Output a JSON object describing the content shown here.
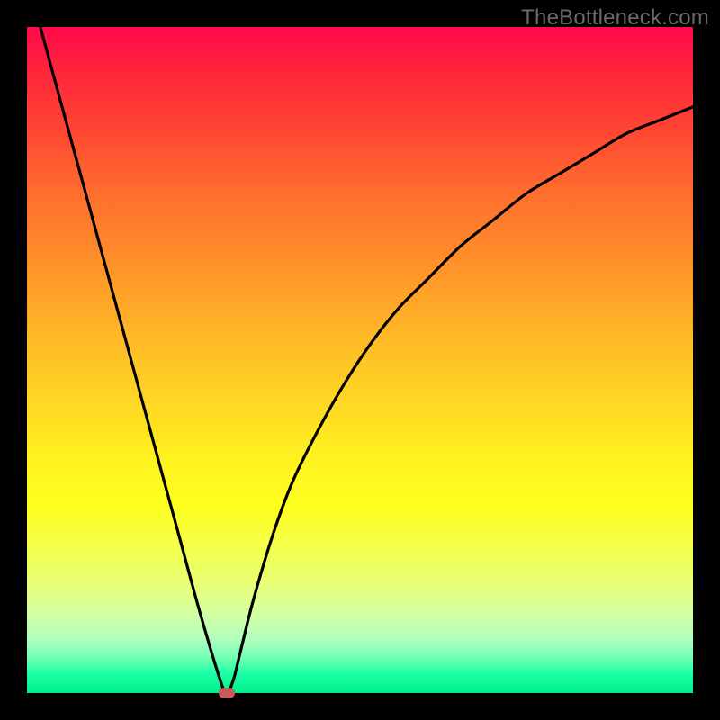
{
  "watermark": "TheBottleneck.com",
  "colors": {
    "frame": "#000000",
    "curve": "#000000",
    "marker": "#c85a5a"
  },
  "chart_data": {
    "type": "line",
    "title": "",
    "xlabel": "",
    "ylabel": "",
    "xlim": [
      0,
      100
    ],
    "ylim": [
      0,
      100
    ],
    "grid": false,
    "series": [
      {
        "name": "bottleneck-curve",
        "x": [
          2,
          5,
          8,
          11,
          14,
          17,
          20,
          23,
          26,
          29,
          30,
          31,
          32,
          34,
          37,
          40,
          44,
          48,
          52,
          56,
          60,
          65,
          70,
          75,
          80,
          85,
          90,
          95,
          100
        ],
        "y": [
          100,
          89,
          78,
          67,
          56,
          45,
          34,
          23,
          12,
          2,
          0,
          2,
          6,
          14,
          24,
          32,
          40,
          47,
          53,
          58,
          62,
          67,
          71,
          75,
          78,
          81,
          84,
          86,
          88
        ]
      }
    ],
    "marker": {
      "x": 30,
      "y": 0
    },
    "background_gradient": [
      "#ff0a4a",
      "#ffd324",
      "#feff20",
      "#00ef89"
    ]
  }
}
